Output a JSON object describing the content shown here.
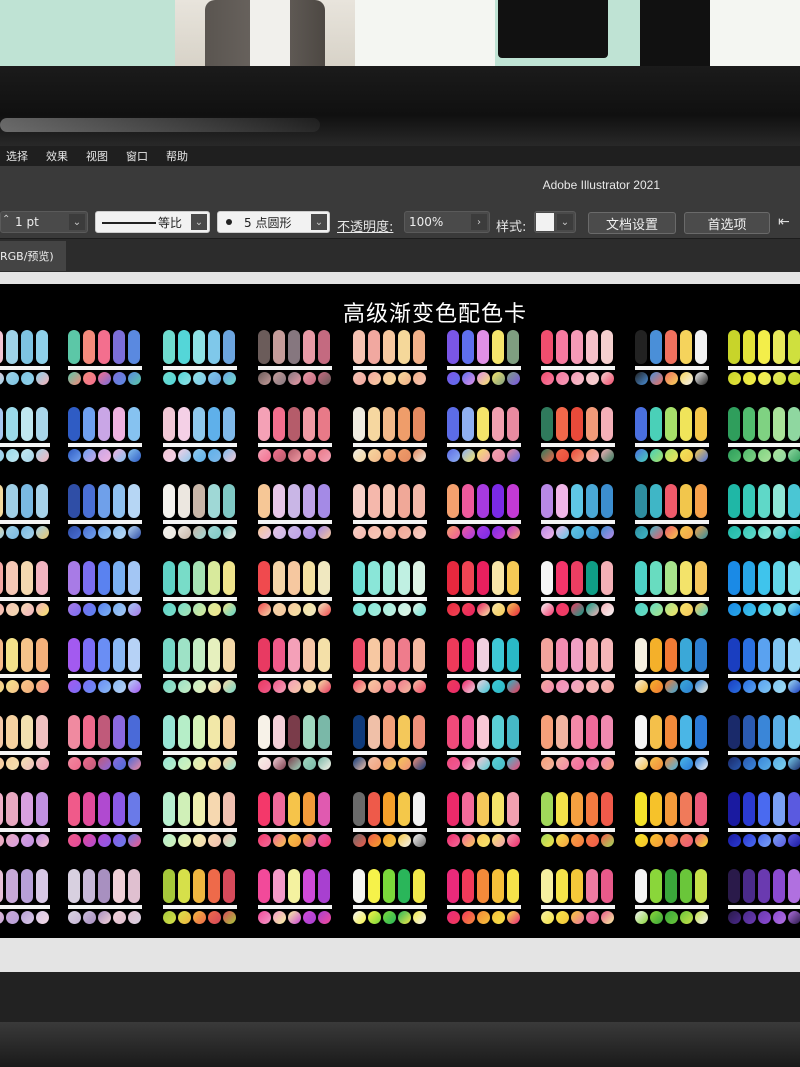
{
  "menu": [
    "选择",
    "效果",
    "视图",
    "窗口",
    "帮助"
  ],
  "app_title": "Adobe Illustrator 2021",
  "control_bar": {
    "stroke_weight": "1 pt",
    "stroke_profile": "等比",
    "brush": "5 点圆形",
    "opacity_label": "不透明度:",
    "opacity_value": "100%",
    "style_label": "样式:",
    "document_setup_button": "文档设置",
    "preferences_button": "首选项"
  },
  "document_tab": "RGB/预览)",
  "artboard_title": "高级渐变色配色卡",
  "colors": {
    "menu_bg": "#1f1f1f",
    "panel_bg": "#3a3a3a",
    "artboard_bg": "#000000",
    "pasteboard": "#e4e4e4"
  },
  "palettes": [
    [
      "#f6b1b6",
      "#f3c6d4",
      "#9fd3e8",
      "#7ec4e2",
      "#8fd1ea"
    ],
    [
      "#5cc7a7",
      "#f58a7c",
      "#f36f8e",
      "#7b6fd9",
      "#5a89e0"
    ],
    [
      "#6fdccf",
      "#54d6d8",
      "#8fe1e5",
      "#7fc8ea",
      "#6ba4de"
    ],
    [
      "#6b5c5a",
      "#c59c9a",
      "#86777f",
      "#e89aa6",
      "#c46a80"
    ],
    [
      "#f6c3b3",
      "#f1a8a0",
      "#f7c9a0",
      "#f5d89a",
      "#f2b18a"
    ],
    [
      "#7a56e6",
      "#5f6fee",
      "#e090e6",
      "#f5e56c",
      "#7f9e80"
    ],
    [
      "#f04e6e",
      "#f77aa0",
      "#f59ab6",
      "#f6c0c9",
      "#f5d0cf"
    ],
    [
      "#222222",
      "#4a8fd8",
      "#f0705e",
      "#f5d35c",
      "#f2f2f2"
    ],
    [
      "#c8d42a",
      "#e3e23a",
      "#f3ee4a",
      "#e8e95c",
      "#cfe03e"
    ],
    [
      "#f6b3bc",
      "#a8c8f1",
      "#9ad9e9",
      "#c0e7f0",
      "#a9d6ea"
    ],
    [
      "#2f5cc4",
      "#6fa0f0",
      "#c9a6e6",
      "#efb2e0",
      "#86c2f0"
    ],
    [
      "#f2c8d6",
      "#f4d0e6",
      "#8ec8ec",
      "#5fb0ea",
      "#7fb9ea"
    ],
    [
      "#f4a1b6",
      "#f36f8e",
      "#b55c6a",
      "#f09aa4",
      "#e87a88"
    ],
    [
      "#f0ece0",
      "#f6d7a0",
      "#f2b98a",
      "#ef9d6a",
      "#e48a60"
    ],
    [
      "#5c6ce6",
      "#8fb0f2",
      "#f4e46a",
      "#f2a0b0",
      "#e98aa0"
    ],
    [
      "#2f7a5c",
      "#f2674a",
      "#e94a3a",
      "#f29a78",
      "#f4b0b8"
    ],
    [
      "#4a6fe0",
      "#4ad0b8",
      "#a6e06a",
      "#f0e45a",
      "#f4c84a"
    ],
    [
      "#2f9e5c",
      "#52bc6e",
      "#7fd282",
      "#a9e29a",
      "#8fd7a0"
    ],
    [
      "#e8c66e",
      "#f4dba0",
      "#9fcfe6",
      "#7ab9e2",
      "#a6d2ea"
    ],
    [
      "#2f4ea6",
      "#4a6fd4",
      "#6fa0ea",
      "#8fc0ef",
      "#b6d6f4"
    ],
    [
      "#f4f2ee",
      "#ece7e0",
      "#c8b6a8",
      "#9fd8d6",
      "#7fc8c4"
    ],
    [
      "#f6c796",
      "#e7c6e8",
      "#c9b6e6",
      "#bfa3e8",
      "#a48ae6"
    ],
    [
      "#f7d0c8",
      "#f5b8ac",
      "#f6c8b6",
      "#f0a898",
      "#f3b8a8"
    ],
    [
      "#f4a06e",
      "#ee5a9c",
      "#a63ae0",
      "#7a2ae6",
      "#c23ad4"
    ],
    [
      "#b889e6",
      "#f0b6e8",
      "#5fc7e6",
      "#4aa8d6",
      "#3c8ecf"
    ],
    [
      "#2e8ea0",
      "#3fb6c6",
      "#ef5a6a",
      "#f2c64c",
      "#f6a24a"
    ],
    [
      "#1fb7a6",
      "#38c9b8",
      "#5fd8c8",
      "#8fe6d6",
      "#4ac6d4"
    ],
    [
      "#f6e26a",
      "#f4a8a4",
      "#f6c8b6",
      "#f4d8b0",
      "#f2b4c0"
    ],
    [
      "#a87be6",
      "#7a6ef0",
      "#5a82f0",
      "#7ab0f2",
      "#a3c6f4"
    ],
    [
      "#5fd2c6",
      "#78dcc8",
      "#a6e2b4",
      "#d8ea9c",
      "#f0e48c"
    ],
    [
      "#f04a4e",
      "#f4d4a8",
      "#f6c8a0",
      "#f4e1a2",
      "#f0e8c0"
    ],
    [
      "#6fe0d6",
      "#8ae6d8",
      "#a4ecdc",
      "#c0f0e2",
      "#dff4e6"
    ],
    [
      "#e7283e",
      "#f04454",
      "#e8205e",
      "#f8e6a8",
      "#f6ca56"
    ],
    [
      "#f6f6f6",
      "#f4356a",
      "#ec3e62",
      "#0f9e86",
      "#f4b0b6"
    ],
    [
      "#4ed2c6",
      "#68dcc0",
      "#a8e48c",
      "#f3e36a",
      "#f6c85c"
    ],
    [
      "#1a8ae6",
      "#28a6e6",
      "#3fc4ec",
      "#62d6e8",
      "#88e2ea"
    ],
    [
      "#f79a8a",
      "#f6bc8a",
      "#f4e28a",
      "#f6c48a",
      "#f4b07a"
    ],
    [
      "#a35af0",
      "#7a6ef6",
      "#6a8ef4",
      "#8ab8f4",
      "#b6d2f6"
    ],
    [
      "#76d8c6",
      "#9ee2c6",
      "#c4ecc4",
      "#e6f0be",
      "#f4d8a8"
    ],
    [
      "#e83a62",
      "#f05a8a",
      "#f4a0b8",
      "#f6c8a8",
      "#f4e0a8"
    ],
    [
      "#f04e6a",
      "#f7c8a2",
      "#f4a092",
      "#ef7c8c",
      "#f4b8a0"
    ],
    [
      "#ee3a5a",
      "#ea2a6a",
      "#f0d0e0",
      "#3ec8d6",
      "#2ab8c6"
    ],
    [
      "#f3a49c",
      "#f38cb0",
      "#f0a0c4",
      "#f5aeb0",
      "#f6b6b8"
    ],
    [
      "#f6f0e0",
      "#f4b02a",
      "#f27a34",
      "#3aa8d8",
      "#2c7fd0"
    ],
    [
      "#1a3ec0",
      "#2a70e0",
      "#5aa2f0",
      "#7ec4f2",
      "#a0dcf4"
    ],
    [
      "#f0a0b4",
      "#f4c8a8",
      "#f6d2a0",
      "#f2e0b0",
      "#f0c0c0"
    ],
    [
      "#f08aa0",
      "#ee6a8c",
      "#c05a7a",
      "#8a6ae0",
      "#4a6ad8"
    ],
    [
      "#98e6d6",
      "#b6eec8",
      "#d6f2b8",
      "#f2e8a8",
      "#f6d0a0"
    ],
    [
      "#f7f2e8",
      "#f4d0d8",
      "#7a3c4a",
      "#a0d8c0",
      "#7ab8a8"
    ],
    [
      "#0f3a7a",
      "#f0c0a8",
      "#f2a07a",
      "#f4c85a",
      "#f0907a"
    ],
    [
      "#f04a7a",
      "#f05a9a",
      "#f8c8d6",
      "#5ad0d6",
      "#46b8c6"
    ],
    [
      "#f6a07a",
      "#f2b4a0",
      "#f48aa8",
      "#f06a9a",
      "#f08ab0"
    ],
    [
      "#f6f6f6",
      "#f4c04a",
      "#f28a3a",
      "#4ab6e6",
      "#2a7ad8"
    ],
    [
      "#1a2a6a",
      "#2a5ab0",
      "#3a86d8",
      "#5aaee6",
      "#7ad0ee"
    ],
    [
      "#f6c0d0",
      "#f0b0c8",
      "#e8a8c0",
      "#d8a0e0",
      "#c090e0"
    ],
    [
      "#f05a8a",
      "#e04a9a",
      "#b04ad0",
      "#8a5ae6",
      "#6a7ae8"
    ],
    [
      "#b8f0d0",
      "#d0f0b8",
      "#f0f0b0",
      "#f6d8b0",
      "#f0c0b0"
    ],
    [
      "#f4386a",
      "#f06a9a",
      "#f6c44a",
      "#f29a3a",
      "#e05ab0"
    ],
    [
      "#6a6a6a",
      "#ee5a4a",
      "#f4a02a",
      "#f4c84a",
      "#f2f2f2"
    ],
    [
      "#ec2a6a",
      "#f46a9a",
      "#f6c85a",
      "#f6e46a",
      "#f2a0b0"
    ],
    [
      "#a0d85a",
      "#f4e24a",
      "#f6a040",
      "#f47a40",
      "#f05a4a"
    ],
    [
      "#f4e22a",
      "#f6c22a",
      "#f49a3a",
      "#f07a5a",
      "#ec5a7a"
    ],
    [
      "#1a1aa0",
      "#2a3ad0",
      "#4a6af0",
      "#7aa0f4",
      "#5a5ae0"
    ],
    [
      "#f2d8e6",
      "#e8c0d8",
      "#c8a8d8",
      "#b8a0d8",
      "#d8c8e6"
    ],
    [
      "#d8d0e0",
      "#c8b8d8",
      "#a890c0",
      "#f0d0d8",
      "#e0c0d0"
    ],
    [
      "#a6c83a",
      "#d6e04a",
      "#f0b640",
      "#ee6a4a",
      "#d64a5a"
    ],
    [
      "#f24a9a",
      "#f49ac8",
      "#f4f2a0",
      "#ce4ad8",
      "#a840d0"
    ],
    [
      "#f6f6f2",
      "#f6f24a",
      "#7ad83a",
      "#2ab65a",
      "#f2e84a"
    ],
    [
      "#ea2a7a",
      "#f23a5a",
      "#f48a3a",
      "#f6c03a",
      "#f6e24a"
    ],
    [
      "#f6f0a0",
      "#f6e44a",
      "#f4c83a",
      "#ee7aa0",
      "#e85a8a"
    ],
    [
      "#f4f4f4",
      "#8ad63a",
      "#3aa63a",
      "#6ac63a",
      "#c6e04a"
    ],
    [
      "#2a1a4a",
      "#4a2a8a",
      "#6a3ab0",
      "#8a4ad0",
      "#b070e0"
    ],
    [
      "#e6dce6",
      "#c8bed2",
      "#a89ec0",
      "#f0e6e6",
      "#d6d0e0"
    ],
    [
      "#f4e6f0",
      "#e4c6e0",
      "#c8a0d8",
      "#9a6ac0",
      "#6a3aa0"
    ],
    [
      "#8ac0e6",
      "#a6d0f0",
      "#f0c0d0",
      "#f6a8b8",
      "#f08aa0"
    ],
    [
      "#f0a0b0",
      "#f4c0d0",
      "#f6e0e6",
      "#f6c86a",
      "#f4a04a"
    ],
    [
      "#f4386a",
      "#3a8ae6",
      "#8a5ae6",
      "#f2a0c0",
      "#f4e0a0"
    ],
    [
      "#ee3a6a",
      "#f2707a",
      "#f6a060",
      "#f6c860",
      "#f6e0a0"
    ],
    [
      "#c8a02a",
      "#b02a2a",
      "#f07a3a",
      "#f6c03a",
      "#2a7a8a"
    ],
    [
      "#2a9ae6",
      "#3ac0e6",
      "#f6c03a",
      "#f49a3a",
      "#2ad0c0"
    ],
    [
      "#4a2a6a",
      "#7a5a9a",
      "#a88ac0",
      "#c8b0d8",
      "#e6d6ec"
    ]
  ]
}
